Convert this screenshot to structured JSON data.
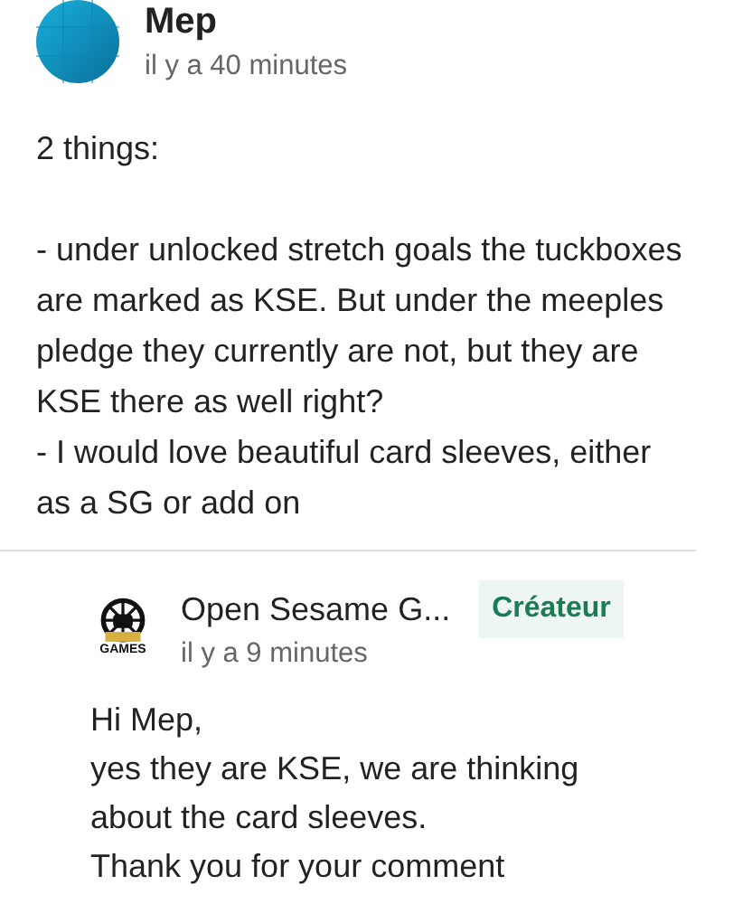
{
  "comment": {
    "author": "Mep",
    "time": "il y a 40 minutes",
    "paragraphs": [
      "2 things:",
      "- under unlocked stretch goals the tuckboxes are marked as KSE. But under the meeples pledge they currently are not, but they are KSE there as well right?\n- I would love beautiful card sleeves, either as a SG or add on"
    ]
  },
  "reply": {
    "author": "Open Sesame G...",
    "badge": "Créateur",
    "time": "il y a 9 minutes",
    "logo_text": "GAMES",
    "paragraphs": [
      "Hi Mep,\nyes they are KSE, we are thinking about the card sleeves.\nThank you for your comment"
    ]
  }
}
